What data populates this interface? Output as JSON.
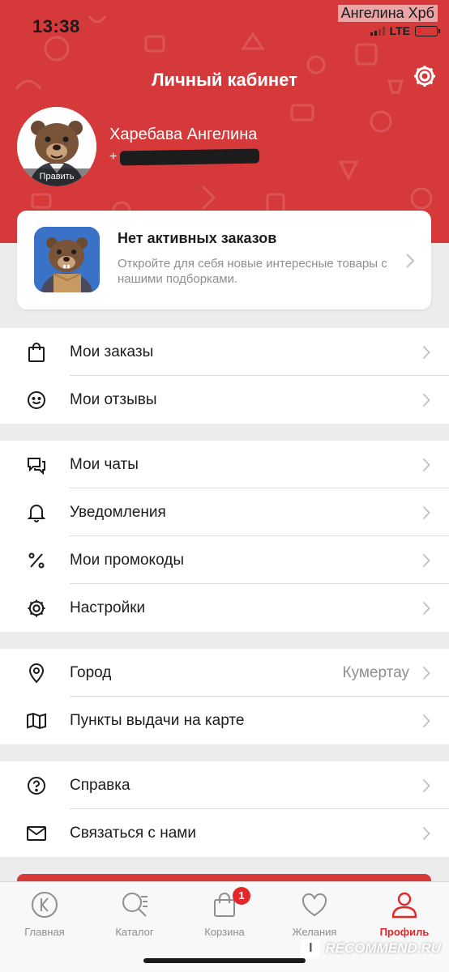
{
  "status_bar": {
    "time": "13:38",
    "carrier_user": "Ангелина Хрб",
    "network": "LTE"
  },
  "header": {
    "title": "Личный кабинет",
    "background_color": "#d6393a",
    "settings_icon": "gear-icon"
  },
  "profile": {
    "name": "Харебава Ангелина",
    "phone_prefix": "+",
    "edit_label": "Править"
  },
  "orders_card": {
    "title": "Нет активных заказов",
    "text": "Откройте для себя новые интересные товары с нашими подборками."
  },
  "menu": {
    "orders": {
      "label": "Мои заказы",
      "icon": "shopping-bag-icon"
    },
    "reviews": {
      "label": "Мои отзывы",
      "icon": "smile-icon"
    },
    "chats": {
      "label": "Мои чаты",
      "icon": "chat-icon"
    },
    "notifications": {
      "label": "Уведомления",
      "icon": "bell-icon"
    },
    "promo": {
      "label": "Мои промокоды",
      "icon": "percent-icon"
    },
    "settings": {
      "label": "Настройки",
      "icon": "gear-icon"
    },
    "city": {
      "label": "Город",
      "value": "Кумертау",
      "icon": "location-pin-icon"
    },
    "pickup": {
      "label": "Пункты выдачи на карте",
      "icon": "map-icon"
    },
    "help": {
      "label": "Справка",
      "icon": "question-icon"
    },
    "contact": {
      "label": "Связаться с нами",
      "icon": "envelope-icon"
    }
  },
  "tabbar": {
    "home": {
      "label": "Главная",
      "icon": "home-logo-icon"
    },
    "catalog": {
      "label": "Каталог",
      "icon": "catalog-search-icon"
    },
    "cart": {
      "label": "Корзина",
      "icon": "cart-bag-icon",
      "badge": "1"
    },
    "wishlist": {
      "label": "Желания",
      "icon": "heart-icon"
    },
    "profile": {
      "label": "Профиль",
      "icon": "user-icon",
      "active": true
    }
  },
  "watermark": {
    "text": "RECOMMEND.RU",
    "mark": "I"
  },
  "colors": {
    "accent": "#e3262a",
    "header": "#d6393a",
    "muted_text": "#8e8e93"
  }
}
